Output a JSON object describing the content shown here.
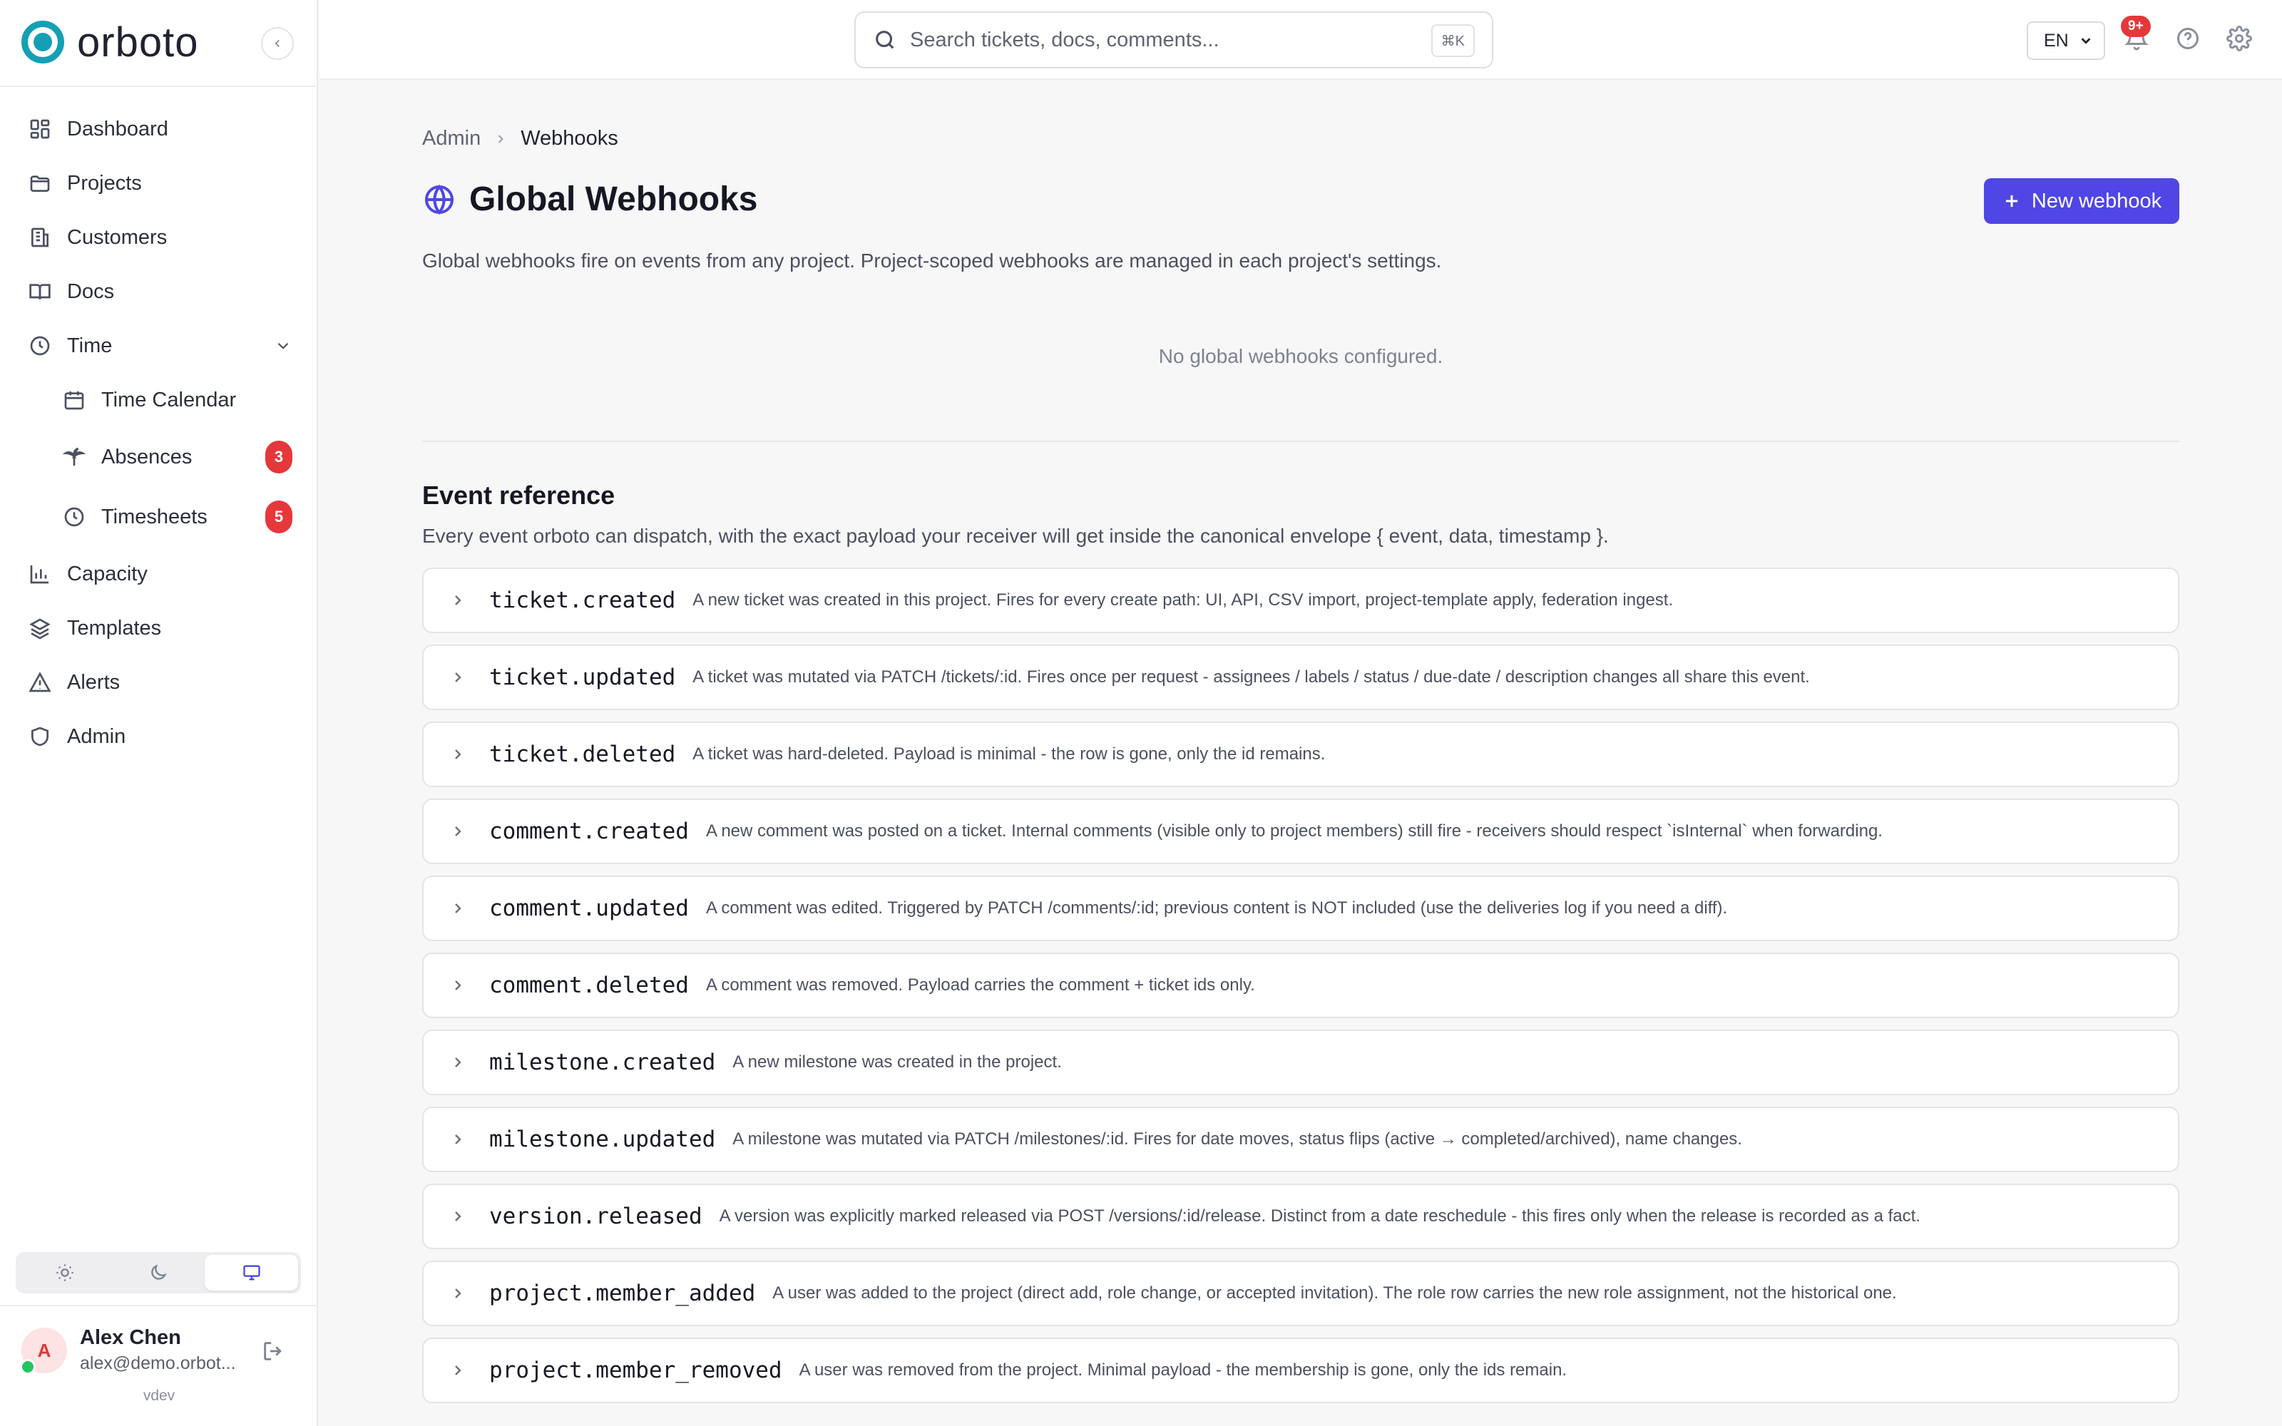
{
  "brand": {
    "name": "orboto"
  },
  "sidebar": {
    "items": [
      {
        "label": "Dashboard",
        "icon": "dashboard-icon"
      },
      {
        "label": "Projects",
        "icon": "folder-icon"
      },
      {
        "label": "Customers",
        "icon": "building-icon"
      },
      {
        "label": "Docs",
        "icon": "book-icon"
      },
      {
        "label": "Time",
        "icon": "clock-icon",
        "expanded": true
      },
      {
        "label": "Time Calendar",
        "icon": "calendar-icon"
      },
      {
        "label": "Absences",
        "icon": "palm-tree-icon",
        "badge": "3"
      },
      {
        "label": "Timesheets",
        "icon": "clock-icon",
        "badge": "5"
      },
      {
        "label": "Capacity",
        "icon": "bar-chart-icon"
      },
      {
        "label": "Templates",
        "icon": "layers-icon"
      },
      {
        "label": "Alerts",
        "icon": "warning-icon"
      },
      {
        "label": "Admin",
        "icon": "shield-icon"
      }
    ],
    "theme": {
      "options": [
        "light",
        "dark",
        "system"
      ],
      "selected": "system"
    },
    "user": {
      "initial": "A",
      "name": "Alex Chen",
      "email": "alex@demo.orbot..."
    },
    "version": "vdev"
  },
  "topbar": {
    "search_placeholder": "Search tickets, docs, comments...",
    "shortcut": "⌘K",
    "language": "EN",
    "notifications_badge": "9+"
  },
  "breadcrumb": {
    "parent": "Admin",
    "current": "Webhooks"
  },
  "page": {
    "title": "Global Webhooks",
    "new_button": "New webhook",
    "description": "Global webhooks fire on events from any project. Project-scoped webhooks are managed in each project's settings.",
    "empty_state": "No global webhooks configured."
  },
  "event_reference": {
    "title": "Event reference",
    "description": "Every event orboto can dispatch, with the exact payload your receiver will get inside the canonical envelope { event, data, timestamp }.",
    "events": [
      {
        "name": "ticket.created",
        "description": "A new ticket was created in this project. Fires for every create path: UI, API, CSV import, project-template apply, federation ingest."
      },
      {
        "name": "ticket.updated",
        "description": "A ticket was mutated via PATCH /tickets/:id. Fires once per request - assignees / labels / status / due-date / description changes all share this event."
      },
      {
        "name": "ticket.deleted",
        "description": "A ticket was hard-deleted. Payload is minimal - the row is gone, only the id remains."
      },
      {
        "name": "comment.created",
        "description": "A new comment was posted on a ticket. Internal comments (visible only to project members) still fire - receivers should respect `isInternal` when forwarding."
      },
      {
        "name": "comment.updated",
        "description": "A comment was edited. Triggered by PATCH /comments/:id; previous content is NOT included (use the deliveries log if you need a diff)."
      },
      {
        "name": "comment.deleted",
        "description": "A comment was removed. Payload carries the comment + ticket ids only."
      },
      {
        "name": "milestone.created",
        "description": "A new milestone was created in the project."
      },
      {
        "name": "milestone.updated",
        "description": "A milestone was mutated via PATCH /milestones/:id. Fires for date moves, status flips (active → completed/archived), name changes."
      },
      {
        "name": "version.released",
        "description": "A version was explicitly marked released via POST /versions/:id/release. Distinct from a date reschedule - this fires only when the release is recorded as a fact."
      },
      {
        "name": "project.member_added",
        "description": "A user was added to the project (direct add, role change, or accepted invitation). The role row carries the new role assignment, not the historical one."
      },
      {
        "name": "project.member_removed",
        "description": "A user was removed from the project. Minimal payload - the membership is gone, only the ids remain."
      }
    ]
  },
  "colors": {
    "accent": "#4f46e5",
    "brand": "#14a0b4",
    "badge": "#e5383b"
  }
}
